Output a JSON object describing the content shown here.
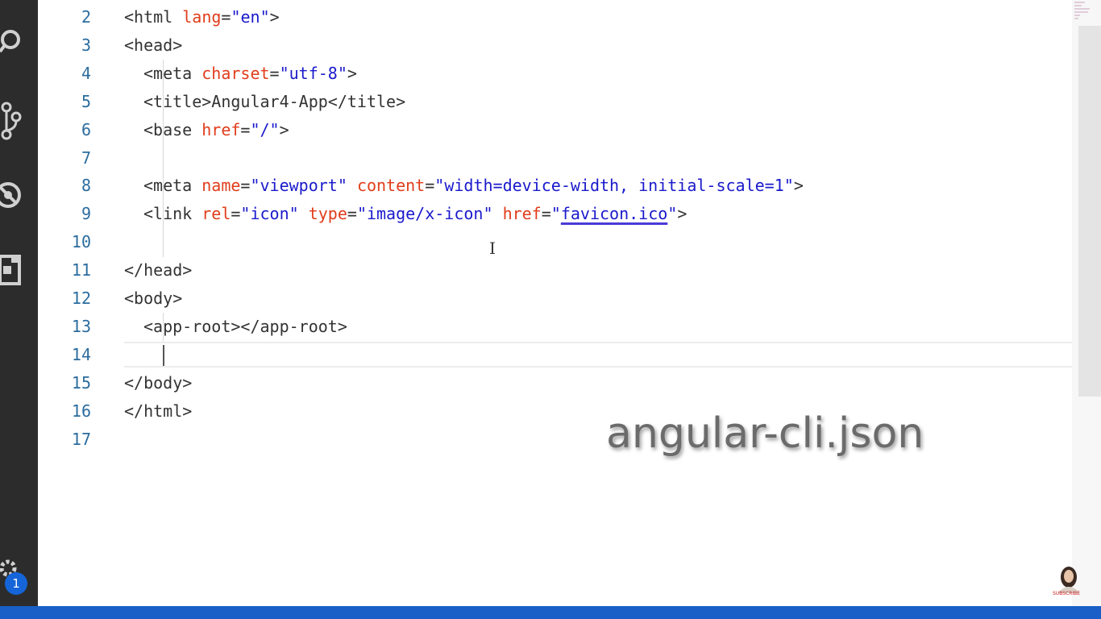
{
  "editor": {
    "lines": [
      {
        "num": "2",
        "indent": 0,
        "tokens": [
          [
            "tag",
            "<html "
          ],
          [
            "attr",
            "lang"
          ],
          [
            "eq",
            "="
          ],
          [
            "str",
            "\"en\""
          ],
          [
            "tag",
            ">"
          ]
        ]
      },
      {
        "num": "3",
        "indent": 0,
        "tokens": [
          [
            "tag",
            "<head>"
          ]
        ]
      },
      {
        "num": "4",
        "indent": 1,
        "tokens": [
          [
            "tag",
            "<meta "
          ],
          [
            "attr",
            "charset"
          ],
          [
            "eq",
            "="
          ],
          [
            "str",
            "\"utf-8\""
          ],
          [
            "tag",
            ">"
          ]
        ]
      },
      {
        "num": "5",
        "indent": 1,
        "tokens": [
          [
            "tag",
            "<title>"
          ],
          [
            "text",
            "Angular4-App"
          ],
          [
            "tag",
            "</title>"
          ]
        ]
      },
      {
        "num": "6",
        "indent": 1,
        "tokens": [
          [
            "tag",
            "<base "
          ],
          [
            "attr",
            "href"
          ],
          [
            "eq",
            "="
          ],
          [
            "str",
            "\"/\""
          ],
          [
            "tag",
            ">"
          ]
        ]
      },
      {
        "num": "7",
        "indent": 0,
        "tokens": []
      },
      {
        "num": "8",
        "indent": 1,
        "tokens": [
          [
            "tag",
            "<meta "
          ],
          [
            "attr",
            "name"
          ],
          [
            "eq",
            "="
          ],
          [
            "str",
            "\"viewport\""
          ],
          [
            "tag",
            " "
          ],
          [
            "attr",
            "content"
          ],
          [
            "eq",
            "="
          ],
          [
            "str",
            "\"width=device-width, initial-scale=1\""
          ],
          [
            "tag",
            ">"
          ]
        ]
      },
      {
        "num": "9",
        "indent": 1,
        "tokens": [
          [
            "tag",
            "<link "
          ],
          [
            "attr",
            "rel"
          ],
          [
            "eq",
            "="
          ],
          [
            "str",
            "\"icon\""
          ],
          [
            "tag",
            " "
          ],
          [
            "attr",
            "type"
          ],
          [
            "eq",
            "="
          ],
          [
            "str",
            "\"image/x-icon\""
          ],
          [
            "tag",
            " "
          ],
          [
            "attr",
            "href"
          ],
          [
            "eq",
            "="
          ],
          [
            "str",
            "\""
          ],
          [
            "link",
            "favicon.ico"
          ],
          [
            "str",
            "\""
          ],
          [
            "tag",
            ">"
          ]
        ]
      },
      {
        "num": "10",
        "indent": 0,
        "tokens": []
      },
      {
        "num": "11",
        "indent": 0,
        "tokens": [
          [
            "tag",
            "</head>"
          ]
        ]
      },
      {
        "num": "12",
        "indent": 0,
        "tokens": [
          [
            "tag",
            "<body>"
          ]
        ]
      },
      {
        "num": "13",
        "indent": 1,
        "tokens": [
          [
            "tag",
            "<app-root></app-root>"
          ]
        ]
      },
      {
        "num": "14",
        "indent": 0,
        "tokens": []
      },
      {
        "num": "15",
        "indent": 0,
        "tokens": [
          [
            "tag",
            "</body>"
          ]
        ]
      },
      {
        "num": "16",
        "indent": 0,
        "tokens": [
          [
            "tag",
            "</html>"
          ]
        ]
      },
      {
        "num": "17",
        "indent": 0,
        "tokens": []
      }
    ]
  },
  "overlay": {
    "caption": "angular-cli.json"
  },
  "activity_bar": {
    "icons": [
      "search-icon",
      "source-control-icon",
      "debug-icon",
      "extensions-icon",
      "gear-icon"
    ],
    "badge_count": "1"
  },
  "colors": {
    "tag": "#333333",
    "attribute": "#e03d1a",
    "string": "#1a1acc",
    "line_number": "#2b6c9e",
    "status_bar": "#1a5fc7",
    "activity_bar": "#2c2c2c"
  },
  "watermark": {
    "subscribe_label": "SUBSCRIBE"
  }
}
